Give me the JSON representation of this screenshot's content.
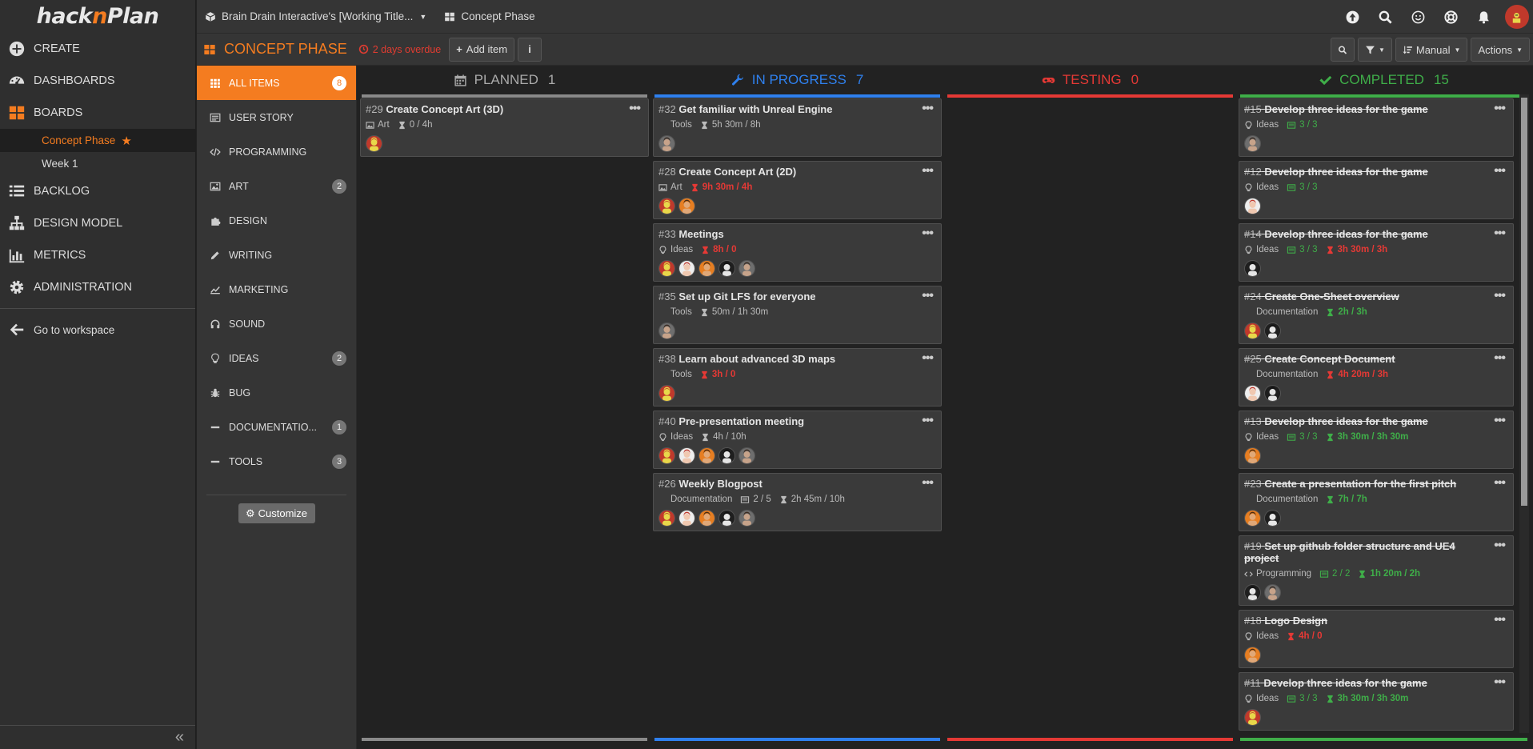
{
  "nav": {
    "logo_a": "hack",
    "logo_n": "n",
    "logo_b": "Plan",
    "items": [
      {
        "label": "CREATE",
        "icon": "plus-circle-icon"
      },
      {
        "label": "DASHBOARDS",
        "icon": "dashboard-icon"
      },
      {
        "label": "BOARDS",
        "icon": "boards-icon"
      }
    ],
    "boards": [
      {
        "label": "Concept Phase",
        "active": true
      },
      {
        "label": "Week 1",
        "active": false
      }
    ],
    "items2": [
      {
        "label": "BACKLOG",
        "icon": "list-icon"
      },
      {
        "label": "DESIGN MODEL",
        "icon": "sitemap-icon"
      },
      {
        "label": "METRICS",
        "icon": "bar-chart-icon"
      },
      {
        "label": "ADMINISTRATION",
        "icon": "gear-icon"
      }
    ],
    "goto": "Go to workspace",
    "collapse": "«"
  },
  "topbar": {
    "project": "Brain Drain Interactive's [Working Title...",
    "board": "Concept Phase"
  },
  "toolbar": {
    "title": "CONCEPT PHASE",
    "overdue": "2 days overdue",
    "add_item": "Add item",
    "info": "i",
    "sort": "Manual",
    "actions": "Actions"
  },
  "categories": [
    {
      "label": "ALL ITEMS",
      "count": "8",
      "active": true,
      "icon": "grid-icon"
    },
    {
      "label": "USER STORY",
      "count": "",
      "icon": "user-story-icon"
    },
    {
      "label": "PROGRAMMING",
      "count": "",
      "icon": "code-icon"
    },
    {
      "label": "ART",
      "count": "2",
      "icon": "image-icon"
    },
    {
      "label": "DESIGN",
      "count": "",
      "icon": "puzzle-icon"
    },
    {
      "label": "WRITING",
      "count": "",
      "icon": "pencil-icon"
    },
    {
      "label": "MARKETING",
      "count": "",
      "icon": "line-chart-icon"
    },
    {
      "label": "SOUND",
      "count": "",
      "icon": "headphones-icon"
    },
    {
      "label": "IDEAS",
      "count": "2",
      "icon": "lightbulb-icon"
    },
    {
      "label": "BUG",
      "count": "",
      "icon": "bug-icon"
    },
    {
      "label": "DOCUMENTATIO...",
      "count": "1",
      "icon": "dash-icon"
    },
    {
      "label": "TOOLS",
      "count": "3",
      "icon": "dash-icon"
    }
  ],
  "customize": "Customize",
  "columns": [
    {
      "name": "PLANNED",
      "count": "1",
      "color": "#8a8a8a"
    },
    {
      "name": "IN PROGRESS",
      "count": "7",
      "color": "#2f80ed"
    },
    {
      "name": "TESTING",
      "count": "0",
      "color": "#e53935"
    },
    {
      "name": "COMPLETED",
      "count": "15",
      "color": "#3fae49"
    }
  ],
  "cards": {
    "planned": [
      {
        "num": "#29",
        "title": "Create Concept Art (3D)",
        "cat": "Art",
        "caticon": "image",
        "time": "0 / 4h",
        "timecolor": "",
        "avatars": [
          "a1"
        ]
      }
    ],
    "inprogress": [
      {
        "num": "#32",
        "title": "Get familiar with Unreal Engine",
        "cat": "Tools",
        "caticon": "",
        "time": "5h 30m / 8h",
        "timecolor": "",
        "avatars": [
          "a5"
        ]
      },
      {
        "num": "#28",
        "title": "Create Concept Art (2D)",
        "cat": "Art",
        "caticon": "image",
        "time": "9h 30m / 4h",
        "timecolor": "red",
        "avatars": [
          "a1",
          "a3"
        ]
      },
      {
        "num": "#33",
        "title": "Meetings",
        "cat": "Ideas",
        "caticon": "bulb",
        "time": "8h / 0",
        "timecolor": "red",
        "avatars": [
          "a1",
          "a2",
          "a3",
          "a4",
          "a5"
        ]
      },
      {
        "num": "#35",
        "title": "Set up Git LFS for everyone",
        "cat": "Tools",
        "caticon": "",
        "time": "50m / 1h 30m",
        "timecolor": "",
        "avatars": [
          "a5"
        ]
      },
      {
        "num": "#38",
        "title": "Learn about advanced 3D maps",
        "cat": "Tools",
        "caticon": "",
        "time": "3h / 0",
        "timecolor": "red",
        "avatars": [
          "a1"
        ]
      },
      {
        "num": "#40",
        "title": "Pre-presentation meeting",
        "cat": "Ideas",
        "caticon": "bulb",
        "time": "4h / 10h",
        "timecolor": "",
        "avatars": [
          "a1",
          "a2",
          "a3",
          "a4",
          "a5"
        ]
      },
      {
        "num": "#26",
        "title": "Weekly Blogpost",
        "cat": "Documentation",
        "caticon": "",
        "tasks": "2 / 5",
        "taskcolor": "",
        "time": "2h 45m / 10h",
        "timecolor": "",
        "avatars": [
          "a1",
          "a2",
          "a3",
          "a4",
          "a5"
        ]
      }
    ],
    "completed": [
      {
        "num": "#15",
        "title": "Develop three ideas for the game",
        "cat": "Ideas",
        "caticon": "bulb",
        "tasks": "3 / 3",
        "taskcolor": "green",
        "time": "",
        "avatars": [
          "a5"
        ]
      },
      {
        "num": "#12",
        "title": "Develop three ideas for the game",
        "cat": "Ideas",
        "caticon": "bulb",
        "tasks": "3 / 3",
        "taskcolor": "green",
        "time": "",
        "avatars": [
          "a2"
        ]
      },
      {
        "num": "#14",
        "title": "Develop three ideas for the game",
        "cat": "Ideas",
        "caticon": "bulb",
        "tasks": "3 / 3",
        "taskcolor": "green",
        "time": "3h 30m / 3h",
        "timecolor": "red",
        "avatars": [
          "a4"
        ]
      },
      {
        "num": "#24",
        "title": "Create One-Sheet overview",
        "cat": "Documentation",
        "caticon": "",
        "time": "2h / 3h",
        "timecolor": "green",
        "avatars": [
          "a1",
          "a4"
        ]
      },
      {
        "num": "#25",
        "title": "Create Concept Document",
        "cat": "Documentation",
        "caticon": "",
        "time": "4h 20m / 3h",
        "timecolor": "red",
        "avatars": [
          "a2",
          "a4"
        ]
      },
      {
        "num": "#13",
        "title": "Develop three ideas for the game",
        "cat": "Ideas",
        "caticon": "bulb",
        "tasks": "3 / 3",
        "taskcolor": "green",
        "time": "3h 30m / 3h 30m",
        "timecolor": "green",
        "avatars": [
          "a3"
        ]
      },
      {
        "num": "#23",
        "title": "Create a presentation for the first pitch",
        "cat": "Documentation",
        "caticon": "",
        "time": "7h / 7h",
        "timecolor": "green",
        "avatars": [
          "a3",
          "a4"
        ]
      },
      {
        "num": "#19",
        "title": "Set up github folder structure and UE4 project",
        "cat": "Programming",
        "caticon": "code",
        "tasks": "2 / 2",
        "taskcolor": "green",
        "time": "1h 20m / 2h",
        "timecolor": "green",
        "avatars": [
          "a4",
          "a5"
        ],
        "tall": true
      },
      {
        "num": "#18",
        "title": "Logo Design",
        "cat": "Ideas",
        "caticon": "bulb",
        "time": "4h / 0",
        "timecolor": "red",
        "avatars": [
          "a3"
        ]
      },
      {
        "num": "#11",
        "title": "Develop three ideas for the game",
        "cat": "Ideas",
        "caticon": "bulb",
        "tasks": "3 / 3",
        "taskcolor": "green",
        "time": "3h 30m / 3h 30m",
        "timecolor": "green",
        "avatars": [
          "a1"
        ]
      }
    ]
  }
}
